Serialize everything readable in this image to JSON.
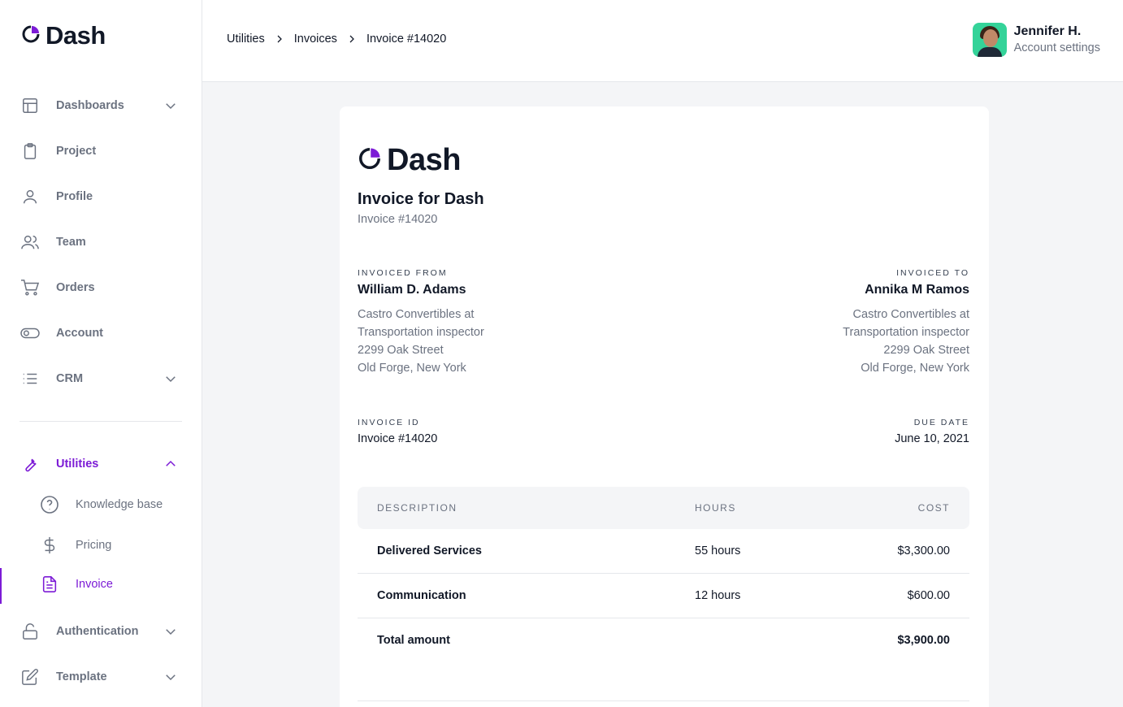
{
  "brand": {
    "name": "Dash",
    "accent": "#7c1bd6"
  },
  "sidebar": {
    "items": [
      {
        "label": "Dashboards",
        "icon": "layout-icon",
        "expandable": true
      },
      {
        "label": "Project",
        "icon": "clipboard-icon"
      },
      {
        "label": "Profile",
        "icon": "user-icon"
      },
      {
        "label": "Team",
        "icon": "users-icon"
      },
      {
        "label": "Orders",
        "icon": "cart-icon"
      },
      {
        "label": "Account",
        "icon": "toggle-icon"
      },
      {
        "label": "CRM",
        "icon": "list-icon",
        "expandable": true
      }
    ],
    "utilities": {
      "label": "Utilities",
      "icon": "wrench-icon",
      "children": [
        {
          "label": "Knowledge base",
          "icon": "help-circle-icon"
        },
        {
          "label": "Pricing",
          "icon": "dollar-icon"
        },
        {
          "label": "Invoice",
          "icon": "file-text-icon",
          "active": true
        }
      ]
    },
    "after": [
      {
        "label": "Authentication",
        "icon": "lock-icon",
        "expandable": true
      },
      {
        "label": "Template",
        "icon": "edit-icon",
        "expandable": true
      }
    ]
  },
  "header": {
    "breadcrumb": [
      "Utilities",
      "Invoices",
      "Invoice #14020"
    ],
    "user": {
      "name": "Jennifer H.",
      "subtitle": "Account settings"
    }
  },
  "invoice": {
    "brand": "Dash",
    "title": "Invoice for Dash",
    "number": "Invoice #14020",
    "from": {
      "caption": "INVOICED FROM",
      "name": "William D. Adams",
      "lines": [
        "Castro Convertibles at",
        "Transportation inspector",
        "2299 Oak Street",
        "Old Forge, New York"
      ]
    },
    "to": {
      "caption": "INVOICED TO",
      "name": "Annika M Ramos",
      "lines": [
        "Castro Convertibles at",
        "Transportation inspector",
        "2299 Oak Street",
        "Old Forge, New York"
      ]
    },
    "id_caption": "INVOICE ID",
    "id_value": "Invoice #14020",
    "due_caption": "DUE DATE",
    "due_value": "June 10, 2021",
    "table": {
      "headers": [
        "DESCRIPTION",
        "HOURS",
        "COST"
      ],
      "rows": [
        {
          "description": "Delivered Services",
          "hours": "55 hours",
          "cost": "$3,300.00"
        },
        {
          "description": "Communication",
          "hours": "12 hours",
          "cost": "$600.00"
        }
      ],
      "total_label": "Total amount",
      "total_value": "$3,900.00"
    }
  }
}
